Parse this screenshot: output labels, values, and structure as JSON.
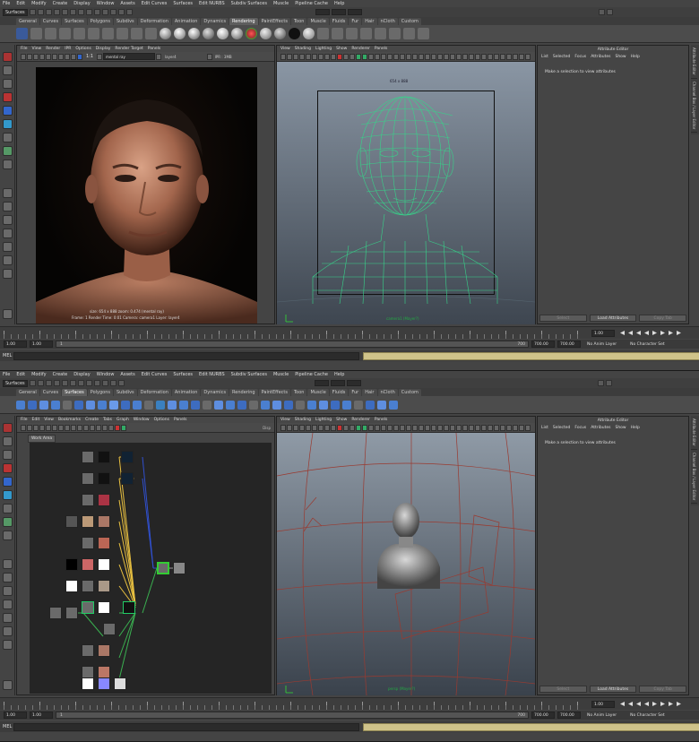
{
  "menu": [
    "File",
    "Edit",
    "Modify",
    "Create",
    "Display",
    "Window",
    "Assets",
    "Edit Curves",
    "Surfaces",
    "Edit NURBS",
    "Subdiv Surfaces",
    "Muscle",
    "Pipeline Cache",
    "Help"
  ],
  "mode_menu": "Surfaces",
  "shelf_tabs_top": [
    "General",
    "Curves",
    "Surfaces",
    "Polygons",
    "Subdivs",
    "Deformation",
    "Animation",
    "Dynamics",
    "Rendering",
    "PaintEffects",
    "Toon",
    "Muscle",
    "Fluids",
    "Fur",
    "Hair",
    "nCloth",
    "Custom"
  ],
  "shelf_tabs_bottom": [
    "General",
    "Curves",
    "Surfaces",
    "Polygons",
    "Subdivs",
    "Deformation",
    "Animation",
    "Dynamics",
    "Rendering",
    "PaintEffects",
    "Toon",
    "Muscle",
    "Fluids",
    "Fur",
    "Hair",
    "nCloth",
    "Custom"
  ],
  "shelf_top_active": "Rendering",
  "shelf_bottom_active": "Surfaces",
  "render_view": {
    "menu": [
      "File",
      "View",
      "Render",
      "IPR",
      "Options",
      "Display",
      "Render Target",
      "Panels"
    ],
    "ratio": "1:1",
    "renderer": "mental ray",
    "layer": "layer4",
    "ipr": "IPR : 3MB",
    "info_line1": "size: 654 x 888  zoom: 0.474     (mental ray)",
    "info_line2": "Frame: 1    Render Time: 0:01    Camera: camera1    Layer: layer4"
  },
  "persp_view": {
    "menu": [
      "View",
      "Shading",
      "Lighting",
      "Show",
      "Renderer",
      "Panels"
    ],
    "resolution": "654 x 888",
    "camera_label": "camera1 (Mayer?)"
  },
  "attribute_editor": {
    "title": "Attribute Editor",
    "menu": [
      "List",
      "Selected",
      "Focus",
      "Attributes",
      "Show",
      "Help"
    ],
    "message": "Make a selection to view attributes",
    "buttons": [
      "Select",
      "Load Attributes",
      "Copy Tab"
    ]
  },
  "side_tabs": [
    "Attribute Editor",
    "Channel Box / Layer Editor"
  ],
  "hypershade": {
    "menu": [
      "File",
      "Edit",
      "View",
      "Bookmarks",
      "Create",
      "Tabs",
      "Graph",
      "Window",
      "Options",
      "Panels"
    ],
    "tab": "Work Area",
    "disp": "Disp"
  },
  "persp2_view": {
    "menu": [
      "View",
      "Shading",
      "Lighting",
      "Show",
      "Renderer",
      "Panels"
    ],
    "camera_label": "persp (Mayer?)"
  },
  "timeline": {
    "current_frame": "1.00",
    "range_start": "1.00",
    "playback_start": "1.00",
    "slider_start": "1",
    "slider_end": "700",
    "playback_end": "700.00",
    "range_end": "700.00",
    "anim_layer": "No Anim Layer",
    "char_set": "No Character Set"
  },
  "mel_label": "MEL"
}
